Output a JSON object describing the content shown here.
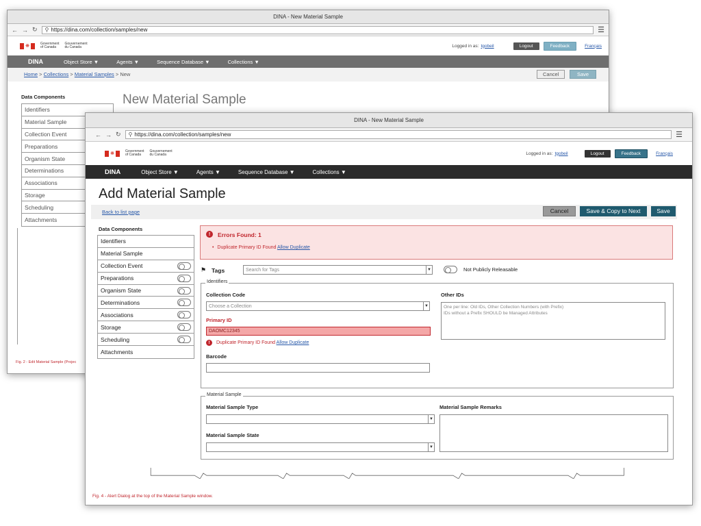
{
  "back_window": {
    "title": "DINA - New Material Sample",
    "url": "https://dina.com/collection/samples/new",
    "gov_en": [
      "Government",
      "of Canada"
    ],
    "gov_fr": [
      "Gouvernement",
      "du Canada"
    ],
    "logged_in_label": "Logged in as:",
    "username": "tgobeil",
    "logout": "Logout",
    "feedback": "Feedback",
    "language": "Français",
    "nav": {
      "brand": "DINA",
      "items": [
        "Object Store",
        "Agents",
        "Sequence Database",
        "Collections"
      ]
    },
    "breadcrumb": {
      "home": "Home",
      "collections": "Collections",
      "samples": "Material Samples",
      "current": "New"
    },
    "cancel": "Cancel",
    "save": "Save",
    "data_components_title": "Data Components",
    "components": [
      "Identifiers",
      "Material Sample",
      "Collection Event",
      "Preparations",
      "Organism State",
      "Determinations",
      "Associations",
      "Storage",
      "Scheduling",
      "Attachments"
    ],
    "page_title": "New Material Sample",
    "caption": "Fig. 2 - Edit Material Sample (Projec"
  },
  "front_window": {
    "title": "DINA - New Material Sample",
    "url": "https://dina.com/collection/samples/new",
    "gov_en": [
      "Government",
      "of Canada"
    ],
    "gov_fr": [
      "Gouvernement",
      "du Canada"
    ],
    "logged_in_label": "Logged in as:",
    "username": "tgobeil",
    "logout": "Logout",
    "feedback": "Feedback",
    "language": "Français",
    "nav": {
      "brand": "DINA",
      "items": [
        "Object Store",
        "Agents",
        "Sequence Database",
        "Collections"
      ]
    },
    "page_title": "Add Material Sample",
    "back_link": "Back to list page",
    "cancel": "Cancel",
    "save_copy_next": "Save & Copy to Next",
    "save": "Save",
    "data_components_title": "Data Components",
    "components": [
      {
        "label": "Identifiers",
        "toggle": false
      },
      {
        "label": "Material Sample",
        "toggle": false
      },
      {
        "label": "Collection Event",
        "toggle": true
      },
      {
        "label": "Preparations",
        "toggle": true
      },
      {
        "label": "Organism State",
        "toggle": true
      },
      {
        "label": "Determinations",
        "toggle": true
      },
      {
        "label": "Associations",
        "toggle": true
      },
      {
        "label": "Storage",
        "toggle": true
      },
      {
        "label": "Scheduling",
        "toggle": true
      },
      {
        "label": "Attachments",
        "toggle": false
      }
    ],
    "alert": {
      "title": "Errors Found: 1",
      "bullet": "•",
      "message": "Duplicate Primary ID Found",
      "action": "Allow Duplicate"
    },
    "tags": {
      "label": "Tags",
      "placeholder": "Search for Tags",
      "not_public": "Not Publicly Releasable"
    },
    "identifiers": {
      "legend": "Identifiers",
      "collection_code_label": "Collection Code",
      "collection_code_placeholder": "Choose a Collection",
      "primary_id_label": "Primary ID",
      "primary_id_value": "DAOMC12345",
      "primary_id_error": "Duplicate Primary ID Found",
      "primary_id_action": "Allow Duplicate",
      "barcode_label": "Barcode",
      "other_ids_label": "Other IDs",
      "other_ids_placeholder_1": "One per line: Old IDs, Other Collection Numbers (with Prefix)",
      "other_ids_placeholder_2": "IDs without a Prefix SHOULD be Managed Attributes"
    },
    "material_sample": {
      "legend": "Material Sample",
      "type_label": "Material Sample Type",
      "state_label": "Material Sample State",
      "remarks_label": "Material Sample Remarks"
    },
    "caption": "Fig. 4 - Alert Dialog at the top of the Material Sample window."
  },
  "colors": {
    "error_red": "#c0262d",
    "alert_bg": "#fbe3e3",
    "teal": "#1f5a6e",
    "navbar": "#2b2b2b"
  }
}
